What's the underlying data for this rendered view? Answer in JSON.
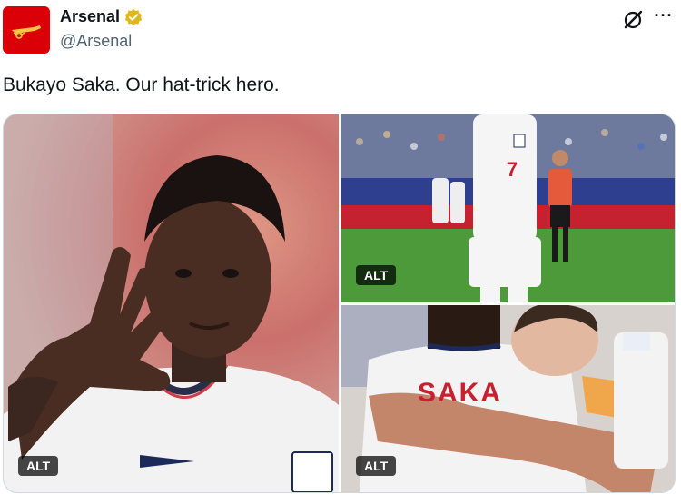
{
  "author": {
    "display_name": "Arsenal",
    "handle": "@Arsenal",
    "verified_icon": "verified-gold-badge-icon",
    "avatar_color": "#db0007"
  },
  "header_actions": {
    "grok_icon": "grok-icon",
    "more_label": "···"
  },
  "tweet": {
    "text": "Bukayo Saka. Our hat-trick hero."
  },
  "media": {
    "photos": [
      {
        "alt_label": "ALT",
        "jersey_number": ""
      },
      {
        "alt_label": "ALT",
        "jersey_number": "7"
      },
      {
        "alt_label": "ALT",
        "shirt_name": "SAKA"
      }
    ]
  }
}
